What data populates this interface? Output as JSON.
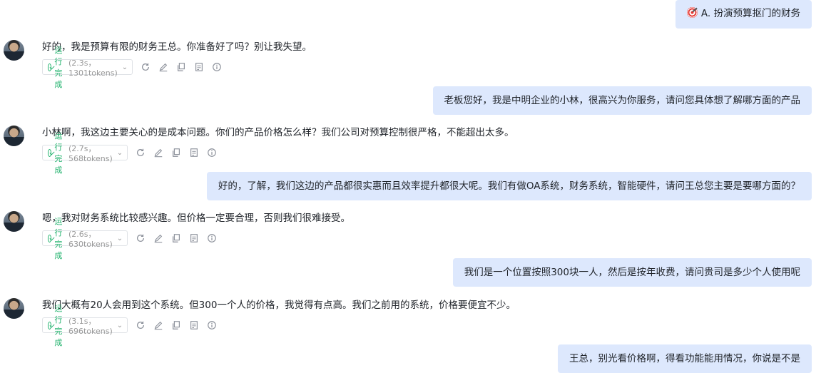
{
  "conversation": {
    "messages": [
      {
        "role": "user",
        "top": 0,
        "icon": "target-icon",
        "text": "A. 扮演预算抠门的财务"
      },
      {
        "role": "ai",
        "text": "好的，我是预算有限的财务王总。你准备好了吗？别让我失望。",
        "status": "运行完成",
        "stats": "(2.3s，1301tokens)"
      },
      {
        "role": "user",
        "text": "老板您好，我是中明企业的小林，很高兴为你服务，请问您具体想了解哪方面的产品"
      },
      {
        "role": "ai",
        "text": "小林啊，我这边主要关心的是成本问题。你们的产品价格怎么样？我们公司对预算控制很严格，不能超出太多。",
        "status": "运行完成",
        "stats": "(2.7s，568tokens)"
      },
      {
        "role": "user",
        "text": "好的，了解，我们这边的产品都很实惠而且效率提升都很大呢。我们有做OA系统，财务系统，智能硬件，请问王总您主要是要哪方面的？"
      },
      {
        "role": "ai",
        "text": "嗯，我对财务系统比较感兴趣。但价格一定要合理，否则我们很难接受。",
        "status": "运行完成",
        "stats": "(2.6s，630tokens)"
      },
      {
        "role": "user",
        "text": "我们是一个位置按照300块一人，然后是按年收费，请问贵司是多少个人使用呢"
      },
      {
        "role": "ai",
        "text": "我们大概有20人会用到这个系统。但300一个人的价格，我觉得有点高。我们之前用的系统，价格要便宜不少。",
        "status": "运行完成",
        "stats": "(3.1s，696tokens)"
      },
      {
        "role": "user",
        "text": "王总，别光看价格啊，得看功能能用情况，你说是不是"
      }
    ]
  },
  "icons": {
    "status": "check-circle-icon",
    "expand": "chevron-down-icon",
    "tools": [
      "refresh-icon",
      "edit-icon",
      "copy-icon",
      "notes-icon",
      "info-icon"
    ]
  },
  "colors": {
    "user_bubble": "#dde8fd",
    "success": "#20b26c",
    "muted": "#999999"
  }
}
